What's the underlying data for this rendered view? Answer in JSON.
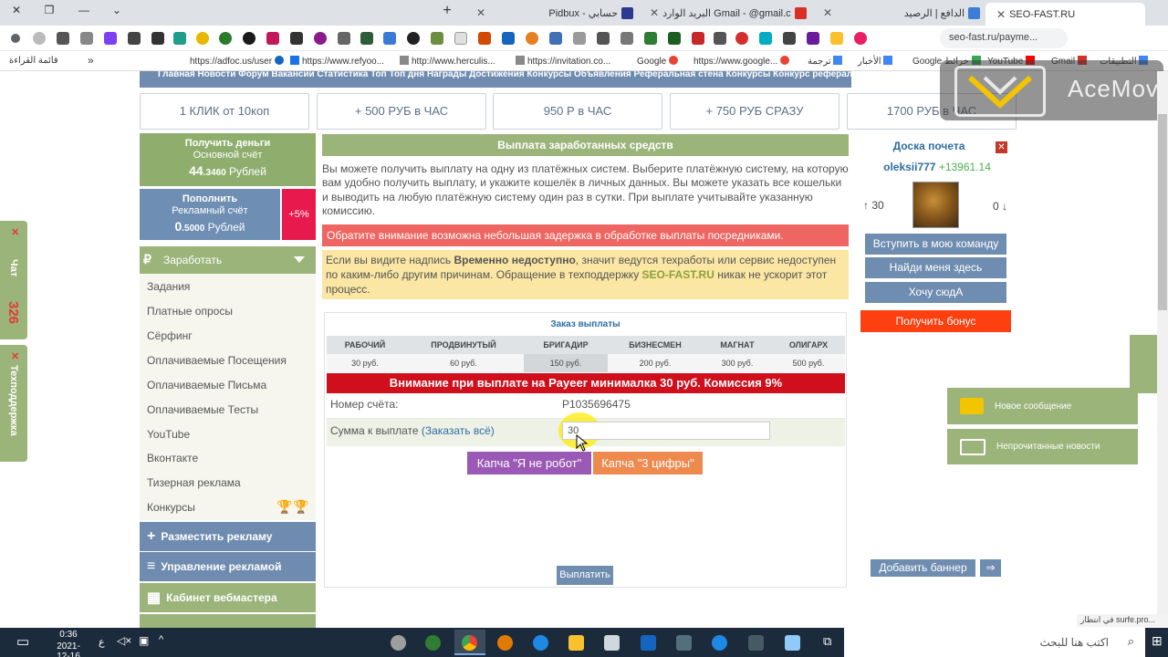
{
  "browser": {
    "tabs": [
      {
        "title": "SEO-FAST.RU"
      },
      {
        "title": "الدافع | الرصيد"
      },
      {
        "title": "البريد الوارد Gmail - @gmail.com"
      },
      {
        "title": "Pidbux - حسابي"
      }
    ],
    "new_tab": "+",
    "address": "seo-fast.ru/payme...",
    "bookmarks": [
      {
        "label": "التطبيقات"
      },
      {
        "label": "Gmail"
      },
      {
        "label": "YouTube"
      },
      {
        "label": "Google خرائط"
      },
      {
        "label": "الأخبار"
      },
      {
        "label": "ترجمة"
      },
      {
        "label": "https://www.google..."
      },
      {
        "label": "Google"
      },
      {
        "label": "https://invitation.co..."
      },
      {
        "label": "http://www.herculis..."
      },
      {
        "label": "https://www.refyoo..."
      },
      {
        "label": "https://adfoc.us/user"
      }
    ],
    "bookmarks_more": "»",
    "reading_list": "قائمة القراءة"
  },
  "watermark": {
    "text": "AceMovi"
  },
  "site": {
    "topnav_text": "Главная  Новости  Форум  Вакансии  Статистика  Топ  Топ дня  Награды  Достижения  Конкурсы  Объявления  Реферальная стена  Конкурсы  Конкурс рефералов",
    "top_buttons": [
      "1 КЛИК от 10коп",
      "+ 500 РУБ в ЧАС",
      "950 Р в ЧАС",
      "+ 750 РУБ СРАЗУ",
      "1700 РУБ в ЧАС"
    ],
    "balance": {
      "get_money": "Получить деньги",
      "main_account": "Основной счёт",
      "main_amount_big": "44",
      "main_amount_small": ".3460",
      "currency": "Рублей",
      "top_up": "Пополнить",
      "ad_account": "Рекламный счёт",
      "ad_amount_big": "0",
      "ad_amount_small": ".5000",
      "bonus_pct": "+5%"
    },
    "earn": {
      "title": "Заработать",
      "currency_icon": "₽"
    },
    "menu": [
      "Задания",
      "Платные опросы",
      "Сёрфинг",
      "Оплачиваемые Посещения",
      "Оплачиваемые Письма",
      "Оплачиваемые Тесты",
      "YouTube",
      "Вконтакте",
      "Тизерная реклама",
      "Конкурсы"
    ],
    "side_buttons": [
      {
        "label": "Разместить рекламу",
        "icon": "+",
        "color": "#6f8bb0"
      },
      {
        "label": "Управление рекламой",
        "icon": "≡",
        "color": "#6f8bb0"
      },
      {
        "label": "Кабинет вебмастера",
        "icon": "▦",
        "color": "#9bb47a"
      }
    ],
    "main": {
      "header": "Выплата заработанных средств",
      "description": "Вы можете получить выплату на одну из платёжных систем. Выберите платёжную систему, на которую вам удобно получить выплату, и укажите кошелёк в личных данных. Вы можете указать все кошельки и выводить на любую платёжную систему один раз в сутки. При выплате учитывайте указанную комиссию.",
      "warning_red": "Обратите внимание возможна небольшая задержка в обработке выплаты посредниками.",
      "warning_yellow_pre": "Если вы видите надпись ",
      "warning_yellow_bold": "Временно недоступно",
      "warning_yellow_mid": ", значит ведутся техработы или сервис недоступен по каким-либо другим причинам. Обращение в техподдержку ",
      "warning_yellow_link": "SEO-FAST.RU",
      "warning_yellow_post": " никак не ускорит этот процесс.",
      "order_title": "Заказ выплаты",
      "tiers": [
        {
          "name": "РАБОЧИЙ",
          "price": "30 руб."
        },
        {
          "name": "ПРОДВИНУТЫЙ",
          "price": "60 руб."
        },
        {
          "name": "БРИГАДИР",
          "price": "150 руб."
        },
        {
          "name": "БИЗНЕСМЕН",
          "price": "200 руб."
        },
        {
          "name": "МАГНАТ",
          "price": "300 руб."
        },
        {
          "name": "ОЛИГАРХ",
          "price": "500 руб."
        }
      ],
      "payeer_notice": "Внимание при выплате на Payeer минималка 30 руб. Комиссия 9%",
      "account_label": "Номер счёта:",
      "account_value": "P1035696475",
      "amount_label": "Сумма к выплате ",
      "order_all": "(Заказать всё)",
      "amount_value": "30",
      "captcha1": "Капча \"Я не робот\"",
      "captcha2": "Капча \"3 цифры\"",
      "pay_button": "Выплатить"
    },
    "honor": {
      "title": "Доска почета",
      "username": "oleksii777",
      "score": "+13961.14",
      "up": "↑ 30",
      "down": "0 ↓",
      "buttons": [
        "Вступить в мою команду",
        "Найди меня здесь",
        "Хочу сюдА"
      ],
      "bonus": "Получить бонус"
    },
    "notifications": [
      "Новое сообщение",
      "Непрочитанные новости"
    ],
    "add_banner": "Добавить баннер",
    "arrow": "⇒",
    "chat_tab": "Чат",
    "chat_count": "326",
    "support_tab": "Техподдержка",
    "status_bar": "في انتظار surfe.pro..."
  },
  "taskbar": {
    "time": "0:36",
    "date": "2021-12-16",
    "lang": "ع",
    "search_placeholder": "اكتب هنا للبحث"
  },
  "colors": {
    "green": "#9bb47a",
    "blue": "#6f8bb0",
    "red": "#d00f1c",
    "orange": "#fe3f10"
  }
}
